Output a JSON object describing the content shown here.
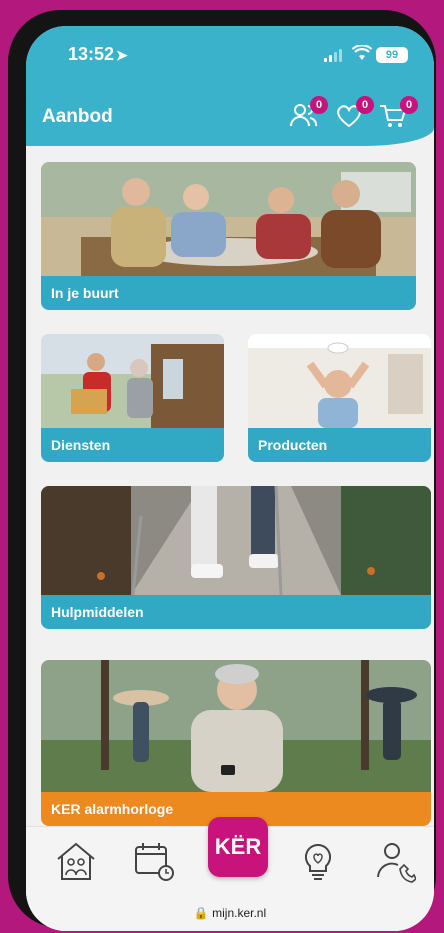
{
  "status": {
    "time": "13:52",
    "battery": "99"
  },
  "header": {
    "title": "Aanbod",
    "icons": [
      {
        "name": "users-icon",
        "badge": "0"
      },
      {
        "name": "heart-icon",
        "badge": "0"
      },
      {
        "name": "cart-icon",
        "badge": "0"
      }
    ]
  },
  "cards": [
    {
      "label": "In je buurt"
    },
    {
      "label": "Diensten"
    },
    {
      "label": "Producten"
    },
    {
      "label": "Hulpmiddelen"
    },
    {
      "label": "KER alarmhorloge"
    }
  ],
  "tabbar": {
    "icons": [
      "home-icon",
      "calendar-icon",
      "lightbulb-icon",
      "contact-icon"
    ],
    "center_logo": "KËR"
  },
  "browser": {
    "url": "mijn.ker.nl"
  },
  "colors": {
    "brand": "#b3197d",
    "header": "#3bb2cc",
    "card_bar": "#31a9c4",
    "accent_orange": "#ec8a20",
    "badge": "#c8137c"
  }
}
